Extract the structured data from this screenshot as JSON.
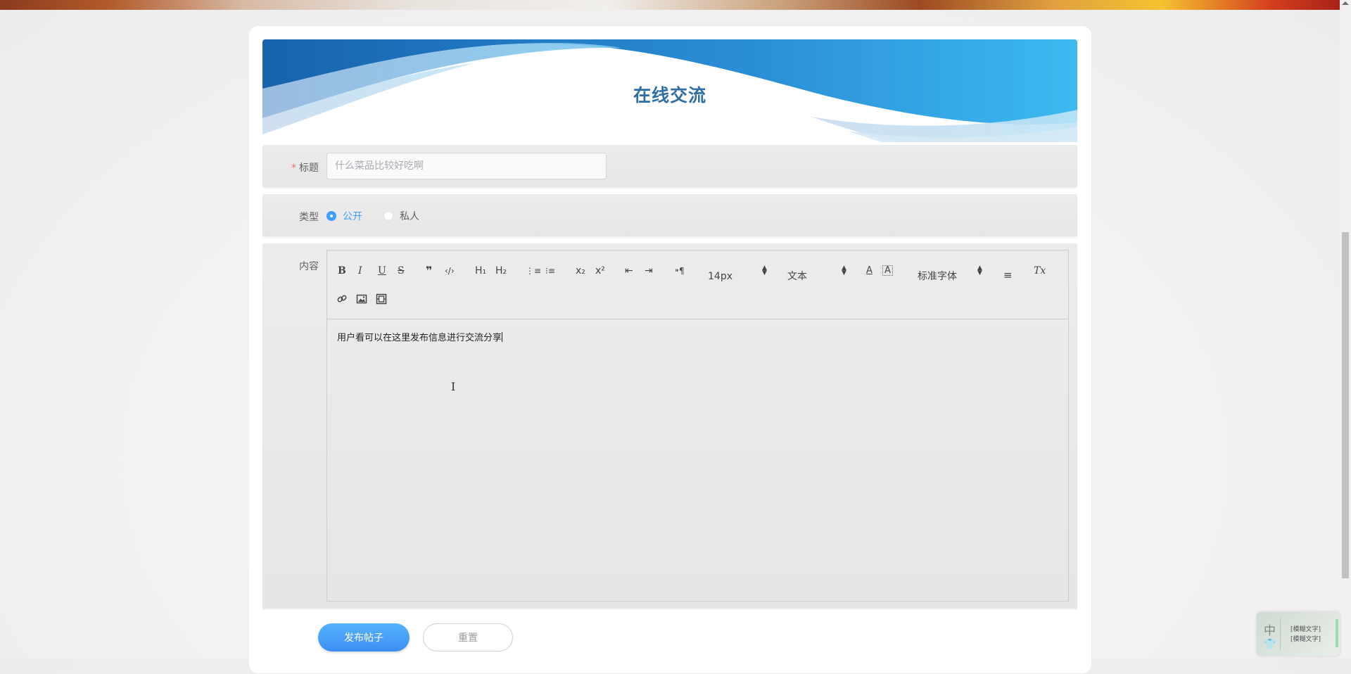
{
  "colors": {
    "accent": "#409eff",
    "header_title": "#2f6ea5",
    "required": "#f56c6c",
    "wave_dark": "#1a6db5",
    "wave_light": "#38b6ea"
  },
  "header": {
    "title": "在线交流"
  },
  "form": {
    "title_field": {
      "label": "标题",
      "required_mark": "*",
      "placeholder": "什么菜品比较好吃啊",
      "value": ""
    },
    "type_field": {
      "label": "类型",
      "options": [
        {
          "label": "公开",
          "checked": true
        },
        {
          "label": "私人",
          "checked": false
        }
      ]
    },
    "content_field": {
      "label": "内容",
      "body_text": "用户看可以在这里发布信息进行交流分享",
      "toolbar": {
        "bold": "B",
        "italic": "I",
        "underline": "U",
        "strike": "S",
        "quote": "❞",
        "code": "‹/›",
        "h1": "H₁",
        "h2": "H₂",
        "ordered_list": "⋮≡",
        "bullet_list": "⁝≡",
        "subscript": "x₂",
        "superscript": "x²",
        "outdent": "⇤",
        "indent": "⇥",
        "direction": "⁍¶",
        "font_size": "14px",
        "header_select": "文本",
        "font_color": "A",
        "background_color": "A",
        "font_family": "标准字体",
        "align": "≡",
        "clean": "Tx",
        "link": "link-icon",
        "image": "image-icon",
        "video": "video-icon"
      }
    }
  },
  "buttons": {
    "submit": "发布帖子",
    "reset": "重置"
  },
  "ime": {
    "char": "中",
    "text1": "[模糊文字]",
    "text2": "[模糊文字]"
  }
}
